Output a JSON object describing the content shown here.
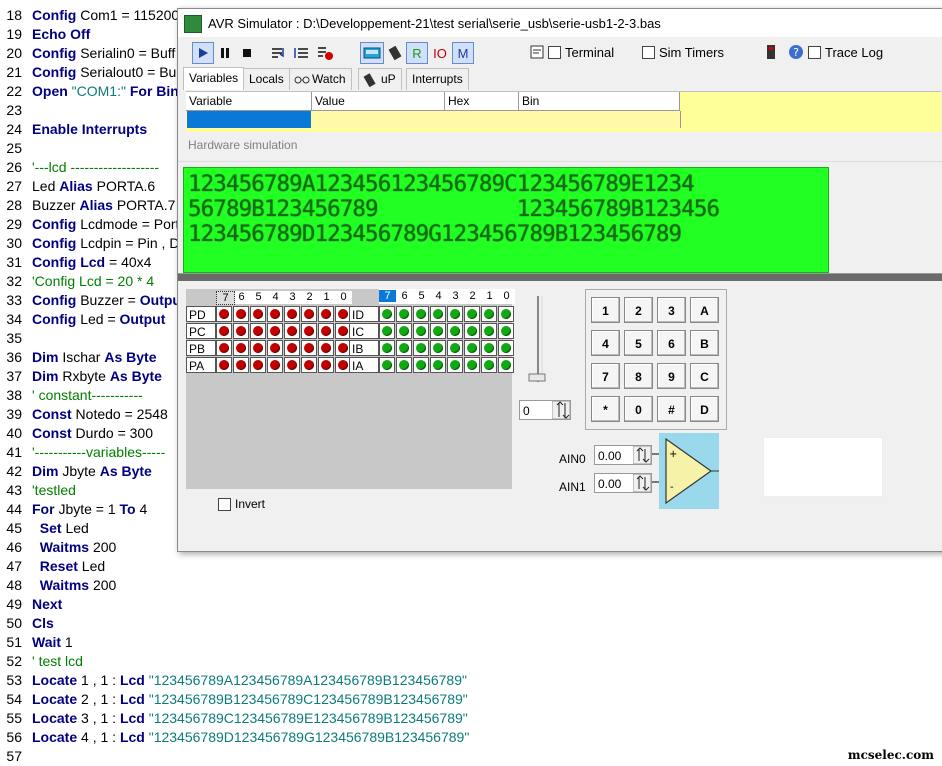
{
  "editor": {
    "lines": [
      {
        "n": "18",
        "parts": [
          {
            "t": "Config",
            "c": "kw"
          },
          {
            "t": " Com1 = 115200"
          }
        ]
      },
      {
        "n": "19",
        "parts": [
          {
            "t": "Echo Off",
            "c": "kw"
          }
        ]
      },
      {
        "n": "20",
        "parts": [
          {
            "t": "Config",
            "c": "kw"
          },
          {
            "t": " Serialin0 = Buff"
          }
        ]
      },
      {
        "n": "21",
        "parts": [
          {
            "t": "Config",
            "c": "kw"
          },
          {
            "t": " Serialout0 = Bu"
          }
        ]
      },
      {
        "n": "22",
        "parts": [
          {
            "t": "Open",
            "c": "kw"
          },
          {
            "t": " "
          },
          {
            "t": "\"COM1:\"",
            "c": "str"
          },
          {
            "t": " For Bin",
            "c": "kw"
          }
        ]
      },
      {
        "n": "23",
        "parts": []
      },
      {
        "n": "24",
        "parts": [
          {
            "t": "Enable Interrupts",
            "c": "kw"
          }
        ]
      },
      {
        "n": "25",
        "parts": []
      },
      {
        "n": "26",
        "parts": [
          {
            "t": "'---lcd -------------------",
            "c": "cm"
          }
        ]
      },
      {
        "n": "27",
        "parts": [
          {
            "t": "Led "
          },
          {
            "t": "Alias",
            "c": "kw"
          },
          {
            "t": " PORTA.6"
          }
        ]
      },
      {
        "n": "28",
        "parts": [
          {
            "t": "Buzzer "
          },
          {
            "t": "Alias",
            "c": "kw"
          },
          {
            "t": " PORTA.7"
          }
        ]
      },
      {
        "n": "29",
        "parts": [
          {
            "t": "Config",
            "c": "kw"
          },
          {
            "t": " Lcdmode = Port"
          }
        ]
      },
      {
        "n": "30",
        "parts": [
          {
            "t": "Config",
            "c": "kw"
          },
          {
            "t": " Lcdpin = Pin , D"
          }
        ]
      },
      {
        "n": "31",
        "parts": [
          {
            "t": "Config Lcd",
            "c": "kw"
          },
          {
            "t": " = 40x4"
          }
        ]
      },
      {
        "n": "32",
        "parts": [
          {
            "t": "'Config Lcd = 20 * 4",
            "c": "cm"
          }
        ]
      },
      {
        "n": "33",
        "parts": [
          {
            "t": "Config",
            "c": "kw"
          },
          {
            "t": " Buzzer = "
          },
          {
            "t": "Outpu",
            "c": "kw"
          }
        ]
      },
      {
        "n": "34",
        "parts": [
          {
            "t": "Config",
            "c": "kw"
          },
          {
            "t": " Led = "
          },
          {
            "t": "Output",
            "c": "kw"
          }
        ]
      },
      {
        "n": "35",
        "parts": []
      },
      {
        "n": "36",
        "parts": [
          {
            "t": "Dim",
            "c": "kw"
          },
          {
            "t": " Ischar "
          },
          {
            "t": "As Byte",
            "c": "kw"
          }
        ]
      },
      {
        "n": "37",
        "parts": [
          {
            "t": "Dim",
            "c": "kw"
          },
          {
            "t": " Rxbyte "
          },
          {
            "t": "As Byte",
            "c": "kw"
          }
        ]
      },
      {
        "n": "38",
        "parts": [
          {
            "t": "' constant-----------",
            "c": "cm"
          }
        ]
      },
      {
        "n": "39",
        "parts": [
          {
            "t": "Const",
            "c": "kw"
          },
          {
            "t": " Notedo = 2548"
          }
        ]
      },
      {
        "n": "40",
        "parts": [
          {
            "t": "Const",
            "c": "kw"
          },
          {
            "t": " Durdo = 300"
          }
        ]
      },
      {
        "n": "41",
        "parts": [
          {
            "t": "'-----------variables-----",
            "c": "cm"
          }
        ]
      },
      {
        "n": "42",
        "parts": [
          {
            "t": "Dim",
            "c": "kw"
          },
          {
            "t": " Jbyte "
          },
          {
            "t": "As Byte",
            "c": "kw"
          }
        ]
      },
      {
        "n": "43",
        "parts": [
          {
            "t": "'testled",
            "c": "cm"
          }
        ]
      },
      {
        "n": "44",
        "parts": [
          {
            "t": "For",
            "c": "kw"
          },
          {
            "t": " Jbyte = 1 "
          },
          {
            "t": "To",
            "c": "kw"
          },
          {
            "t": " 4"
          }
        ]
      },
      {
        "n": "45",
        "parts": [
          {
            "t": "  "
          },
          {
            "t": "Set",
            "c": "kw"
          },
          {
            "t": " Led"
          }
        ]
      },
      {
        "n": "46",
        "parts": [
          {
            "t": "  "
          },
          {
            "t": "Waitms",
            "c": "kw"
          },
          {
            "t": " 200"
          }
        ]
      },
      {
        "n": "47",
        "parts": [
          {
            "t": "  "
          },
          {
            "t": "Reset",
            "c": "kw"
          },
          {
            "t": " Led"
          }
        ]
      },
      {
        "n": "48",
        "parts": [
          {
            "t": "  "
          },
          {
            "t": "Waitms",
            "c": "kw"
          },
          {
            "t": " 200"
          }
        ]
      },
      {
        "n": "49",
        "parts": [
          {
            "t": "Next",
            "c": "kw"
          }
        ]
      },
      {
        "n": "50",
        "parts": [
          {
            "t": "Cls",
            "c": "kw"
          }
        ]
      },
      {
        "n": "51",
        "parts": [
          {
            "t": "Wait",
            "c": "kw"
          },
          {
            "t": " 1"
          }
        ]
      },
      {
        "n": "52",
        "parts": [
          {
            "t": "' test lcd",
            "c": "cm"
          }
        ]
      },
      {
        "n": "53",
        "parts": [
          {
            "t": "Locate",
            "c": "kw"
          },
          {
            "t": " 1 , 1 : "
          },
          {
            "t": "Lcd",
            "c": "kw"
          },
          {
            "t": " "
          },
          {
            "t": "\"123456789A123456789A123456789B123456789\"",
            "c": "str"
          }
        ]
      },
      {
        "n": "54",
        "parts": [
          {
            "t": "Locate",
            "c": "kw"
          },
          {
            "t": " 2 , 1 : "
          },
          {
            "t": "Lcd",
            "c": "kw"
          },
          {
            "t": " "
          },
          {
            "t": "\"123456789B123456789C123456789B123456789\"",
            "c": "str"
          }
        ]
      },
      {
        "n": "55",
        "parts": [
          {
            "t": "Locate",
            "c": "kw"
          },
          {
            "t": " 3 , 1 : "
          },
          {
            "t": "Lcd",
            "c": "kw"
          },
          {
            "t": " "
          },
          {
            "t": "\"123456789C123456789E123456789B123456789\"",
            "c": "str"
          }
        ]
      },
      {
        "n": "56",
        "parts": [
          {
            "t": "Locate",
            "c": "kw"
          },
          {
            "t": " 4 , 1 : "
          },
          {
            "t": "Lcd",
            "c": "kw"
          },
          {
            "t": " "
          },
          {
            "t": "\"123456789D123456789G123456789B123456789\"",
            "c": "str"
          }
        ]
      },
      {
        "n": "57",
        "parts": []
      }
    ],
    "watermark": "mcselec.com"
  },
  "sim": {
    "title": "AVR Simulator : D:\\Developpement-21\\test serial\\serie_usb\\serie-usb1-2-3.bas",
    "toolbar": {
      "terminal_label": "Terminal",
      "sim_timers_label": "Sim Timers",
      "trace_log_label": "Trace Log",
      "r_label": "R",
      "io_label": "IO",
      "m_label": "M"
    },
    "tabs": [
      "Variables",
      "Locals",
      "Watch",
      "uP",
      "Interrupts"
    ],
    "grid_columns": [
      "Variable",
      "Value",
      "Hex",
      "Bin"
    ],
    "hw_label": "Hardware simulation",
    "lcd_lines": [
      "123456789A123456123456789C123456789E1234",
      "56789B123456789           123456789B123456",
      "123456789D123456789G123456789B123456789"
    ],
    "ports": {
      "bits": [
        "7",
        "6",
        "5",
        "4",
        "3",
        "2",
        "1",
        "0"
      ],
      "out_labels": [
        "PD",
        "PC",
        "PB",
        "PA"
      ],
      "in_labels": [
        "ID",
        "IC",
        "IB",
        "IA"
      ]
    },
    "invert_label": "Invert",
    "spin_value": "0",
    "keypad": [
      "1",
      "2",
      "3",
      "A",
      "4",
      "5",
      "6",
      "B",
      "7",
      "8",
      "9",
      "C",
      "*",
      "0",
      "#",
      "D"
    ],
    "ain0_label": "AIN0",
    "ain1_label": "AIN1",
    "ain0_value": "0.00",
    "ain1_value": "0.00"
  }
}
